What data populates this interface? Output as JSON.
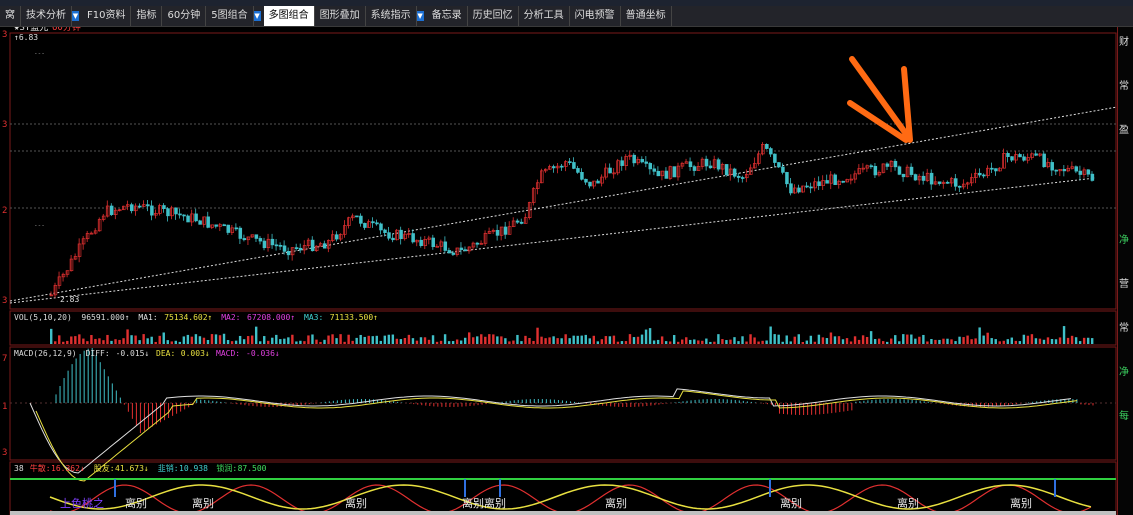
{
  "toolbar": {
    "items": [
      {
        "label": "窝",
        "caret": false,
        "active": false
      },
      {
        "label": "技术分析",
        "caret": true,
        "active": false
      },
      {
        "label": "F10资料",
        "caret": false,
        "active": false
      },
      {
        "label": "指标",
        "caret": false,
        "active": false
      },
      {
        "label": "60分钟",
        "caret": false,
        "active": false
      },
      {
        "label": "5图组合",
        "caret": true,
        "active": false
      },
      {
        "label": "多图组合",
        "caret": false,
        "active": true
      },
      {
        "label": "图形叠加",
        "caret": false,
        "active": false
      },
      {
        "label": "系统指示",
        "caret": true,
        "active": false
      },
      {
        "label": "备忘录",
        "caret": false,
        "active": false
      },
      {
        "label": "历史回忆",
        "caret": false,
        "active": false
      },
      {
        "label": "分析工具",
        "caret": false,
        "active": false
      },
      {
        "label": "闪电预警",
        "caret": false,
        "active": false
      },
      {
        "label": "普通坐标",
        "caret": false,
        "active": false
      }
    ]
  },
  "main_chart": {
    "title": "★ST蓝光",
    "period": "60分钟",
    "high_marker": "↑6.83",
    "low_marker": "2.83",
    "y_ticks": [
      "3",
      "3",
      "2",
      "3"
    ],
    "colors": {
      "up": "#e03030",
      "down": "#40c0c8",
      "trendline": "#dddddd",
      "arrow": "#ff6a13"
    }
  },
  "vol_panel": {
    "name": "VOL(5,10,20)",
    "value": "96591.000↑",
    "ma1_label": "MA1:",
    "ma1_value": "75134.602↑",
    "ma2_label": "MA2:",
    "ma2_value": "67208.000↑",
    "ma3_label": "MA3:",
    "ma3_value": "71133.500↑"
  },
  "macd_panel": {
    "name": "MACD(26,12,9)",
    "diff_label": "DIFF:",
    "diff_value": "-0.015↓",
    "dea_label": "DEA:",
    "dea_value": "0.003↓",
    "macd_label": "MACD:",
    "macd_value": "-0.036↓",
    "y_ticks": [
      "7",
      "1",
      "3"
    ]
  },
  "bottom_panel": {
    "index": "38",
    "l1_label": "牛散:",
    "l1_value": "16.362↓",
    "l2_label": "股友:",
    "l2_value": "41.673↓",
    "l3_label": "韭销:",
    "l3_value": "10.938",
    "l4_label": "锁润:",
    "l4_value": "87.500",
    "annotations": [
      "上色桃之",
      "离别",
      "离别",
      "离别",
      "离别离别",
      "离别",
      "离别",
      "离别",
      "离别"
    ]
  },
  "right_panel": {
    "labels": [
      "财",
      "",
      "常",
      "",
      "盈",
      "",
      "",
      "",
      "",
      "净",
      "",
      "营",
      "",
      "常",
      "",
      "净",
      "",
      "每"
    ]
  }
}
